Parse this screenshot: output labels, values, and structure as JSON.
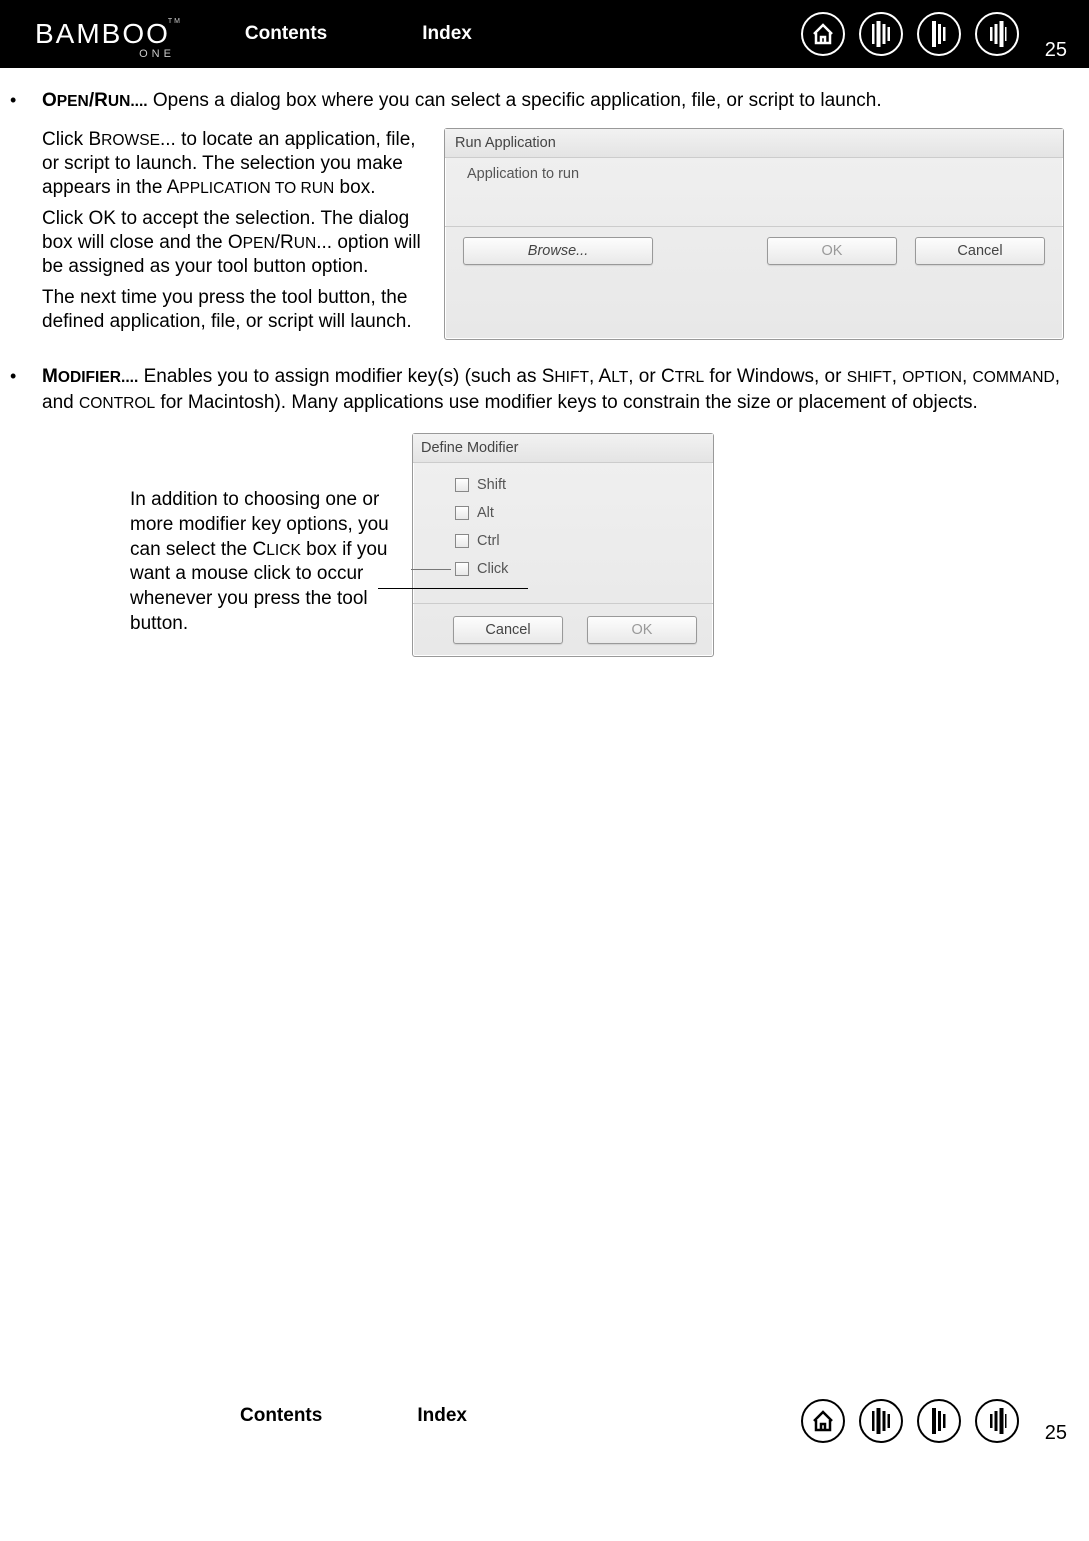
{
  "logo": {
    "main": "BAMBOO",
    "sub": "ONE",
    "tm": "TM"
  },
  "nav": {
    "contents": "Contents",
    "index": "Index"
  },
  "page_number": "25",
  "section1": {
    "title_strong": "O",
    "title_sc": "PEN",
    "title_slash": "/R",
    "title_sc2": "UN....",
    "desc": "  Opens a dialog box where you can select a specific application, file, or script to launch.",
    "p1a": "Click B",
    "p1b": "ROWSE",
    "p1c": "... to locate an application, file, or script to launch.  The selection you make appears in the A",
    "p1d": "PPLICATION TO RUN",
    "p1e": " box.",
    "p2a": "Click OK to accept the selection.  The dialog box will close and the O",
    "p2b": "PEN",
    "p2c": "/R",
    "p2d": "UN",
    "p2e": "... option will be assigned as your tool button option.",
    "p3": "The next time you press the tool button, the defined application, file, or script will launch."
  },
  "dialog1": {
    "title": "Run Application",
    "label": "Application to run",
    "browse": "Browse...",
    "ok": "OK",
    "cancel": "Cancel"
  },
  "section2": {
    "title_strong": "M",
    "title_sc": "ODIFIER....",
    "desc_a": "  Enables you to assign modifier key(s) (such as S",
    "desc_b": "HIFT",
    "desc_c": ", A",
    "desc_d": "LT",
    "desc_e": ", or C",
    "desc_f": "TRL",
    "desc_g": " for Windows, or ",
    "desc_h": "SHIFT",
    "desc_i": ", ",
    "desc_j": "OPTION",
    "desc_k": ", ",
    "desc_l": "COMMAND",
    "desc_m": ", and ",
    "desc_n": "CONTROL",
    "desc_o": " for Macintosh).  Many applications use modifier keys to constrain the size or placement of objects.",
    "note_a": "In addition to choosing one or more modifier key options, you can select the C",
    "note_b": "LICK",
    "note_c": " box if you want a mouse click to occur whenever you press the tool button."
  },
  "dialog2": {
    "title": "Define Modifier",
    "shift": "Shift",
    "alt": "Alt",
    "ctrl": "Ctrl",
    "click": "Click",
    "cancel": "Cancel",
    "ok": "OK"
  }
}
